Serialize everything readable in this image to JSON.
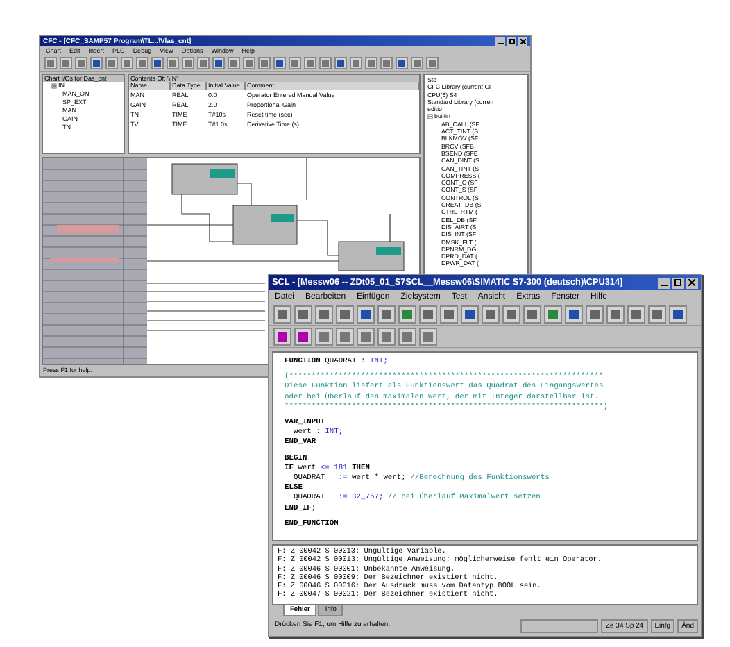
{
  "cfc_window": {
    "title": "CFC - [CFC_SAMP57 Program\\TL...\\Vlas_cnt]",
    "menu": [
      "Chart",
      "Edit",
      "Insert",
      "PLC",
      "Debug",
      "View",
      "Options",
      "Window",
      "Help"
    ],
    "io_tree": {
      "header": "Chart I/Os for Das_cnt",
      "items": [
        {
          "label": "IN",
          "expanded": true,
          "children": [
            {
              "label": "MAN_ON"
            },
            {
              "label": "SP_EXT"
            },
            {
              "label": "MAN"
            },
            {
              "label": "GAIN"
            },
            {
              "label": "TN"
            }
          ]
        }
      ]
    },
    "io_table": {
      "header": "Contents Of: '\\IN'",
      "columns": [
        "Name",
        "Data Type",
        "Initial Value",
        "Comment"
      ],
      "rows": [
        [
          "MAN",
          "REAL",
          "0.0",
          "Operator Entered Manual Value"
        ],
        [
          "GAIN",
          "REAL",
          "2.0",
          "Proportional Gain"
        ],
        [
          "TN",
          "TIME",
          "T#10s",
          "Reset time (sec)"
        ],
        [
          "TV",
          "TIME",
          "T#1.0s",
          "Derivative Time (s)"
        ]
      ]
    },
    "library": {
      "items": [
        {
          "label": "Std"
        },
        {
          "label": "CFC Library (current CF"
        },
        {
          "label": "CPU(6) S4"
        },
        {
          "label": "Standard Library (curren"
        },
        {
          "label": "editio"
        },
        {
          "label": "builtin",
          "expanded": true,
          "children": [
            {
              "label": "AB_CALL (SF"
            },
            {
              "label": "ACT_TINT (S"
            },
            {
              "label": "BLKMOV (SF"
            },
            {
              "label": "BRCV (SFB"
            },
            {
              "label": "BSEND (SFE"
            },
            {
              "label": "CAN_DINT (S"
            },
            {
              "label": "CAN_TINT (S"
            },
            {
              "label": "COMPRESS ("
            },
            {
              "label": "CONT_C (SF"
            },
            {
              "label": "CONT_S (SF"
            },
            {
              "label": "CONTROL (S"
            },
            {
              "label": "CREAT_DB (S"
            },
            {
              "label": "CTRL_RTM ("
            },
            {
              "label": "DEL_DB (SF"
            },
            {
              "label": "DIS_AIRT (S"
            },
            {
              "label": "DIS_INT (SF"
            },
            {
              "label": "DMSK_FLT ("
            },
            {
              "label": "DPNRM_DG"
            },
            {
              "label": "DPRD_DAT ("
            },
            {
              "label": "DPWR_DAT ("
            }
          ]
        }
      ]
    },
    "status_bar": "Press F1 for help."
  },
  "scl_window": {
    "title": "SCL - [Messw06 -- ZDt05_01_S7SCL__Messw06\\SIMATIC S7-300 (deutsch)\\CPU314]",
    "menu": [
      "Datei",
      "Bearbeiten",
      "Einfügen",
      "Zielsystem",
      "Test",
      "Ansicht",
      "Extras",
      "Fenster",
      "Hilfe"
    ],
    "code_blocks": [
      [
        [
          {
            "kind": "keyword",
            "text": "FUNCTION"
          },
          {
            "kind": "plain",
            "text": " QUADRAT "
          },
          {
            "kind": "type",
            "text": ": INT;"
          }
        ]
      ],
      [
        [
          {
            "kind": "comment",
            "text": "(**********************************************************************"
          }
        ],
        [
          {
            "kind": "comment",
            "text": "Diese Funktion liefert als Funktionswert das Quadrat des Eingangswertes"
          }
        ],
        [
          {
            "kind": "comment",
            "text": "oder bei Überlauf den maximalen Wert, der mit Integer darstellbar ist."
          }
        ],
        [
          {
            "kind": "comment",
            "text": "***********************************************************************)"
          }
        ]
      ],
      [
        [
          {
            "kind": "keyword",
            "text": "VAR_INPUT"
          }
        ],
        [
          {
            "kind": "plain",
            "text": "  wert "
          },
          {
            "kind": "type",
            "text": ": INT;"
          }
        ],
        [
          {
            "kind": "keyword",
            "text": "END_VAR"
          }
        ]
      ],
      [
        [
          {
            "kind": "keyword",
            "text": "BEGIN"
          }
        ],
        [
          {
            "kind": "keyword",
            "text": "IF"
          },
          {
            "kind": "plain",
            "text": " wert "
          },
          {
            "kind": "type",
            "text": "<= 181 "
          },
          {
            "kind": "keyword",
            "text": "THEN"
          }
        ],
        [
          {
            "kind": "plain",
            "text": "  QUADRAT   "
          },
          {
            "kind": "type",
            "text": ":= "
          },
          {
            "kind": "plain",
            "text": "wert * wert; "
          },
          {
            "kind": "comment",
            "text": "//Berechnung des Funktionswerts"
          }
        ],
        [
          {
            "kind": "keyword",
            "text": "ELSE"
          }
        ],
        [
          {
            "kind": "plain",
            "text": "  QUADRAT   "
          },
          {
            "kind": "type",
            "text": ":= 32_767; "
          },
          {
            "kind": "comment",
            "text": "// bei Überlauf Maximalwert setzen"
          }
        ],
        [
          {
            "kind": "keyword",
            "text": "END_IF"
          },
          {
            "kind": "plain",
            "text": ";"
          }
        ]
      ],
      [
        [
          {
            "kind": "keyword",
            "text": "END_FUNCTION"
          }
        ]
      ]
    ],
    "messages": [
      "F: Z 00042 S 00013: Ungültige Variable.",
      "F: Z 00042 S 00013: Ungültige Anweisung; möglicherweise fehlt ein Operator.",
      "F: Z 00046 S 00001: Unbekannte Anweisung.",
      "F: Z 00046 S 00009: Der Bezeichner existiert nicht.",
      "F: Z 00046 S 00016: Der Ausdruck muss vom Datentyp BOOL sein.",
      "F: Z 00047 S 00021: Der Bezeichner existiert nicht."
    ],
    "tabs": [
      {
        "label": "Fehler",
        "selected": true
      },
      {
        "label": "Info",
        "selected": false
      }
    ],
    "status_bar": {
      "message": "Drücken Sie F1, um Hilfe zu erhalten.",
      "position": "Ze 34 Sp 24",
      "insert_mode": "Einfg",
      "modified": "Änd"
    }
  }
}
